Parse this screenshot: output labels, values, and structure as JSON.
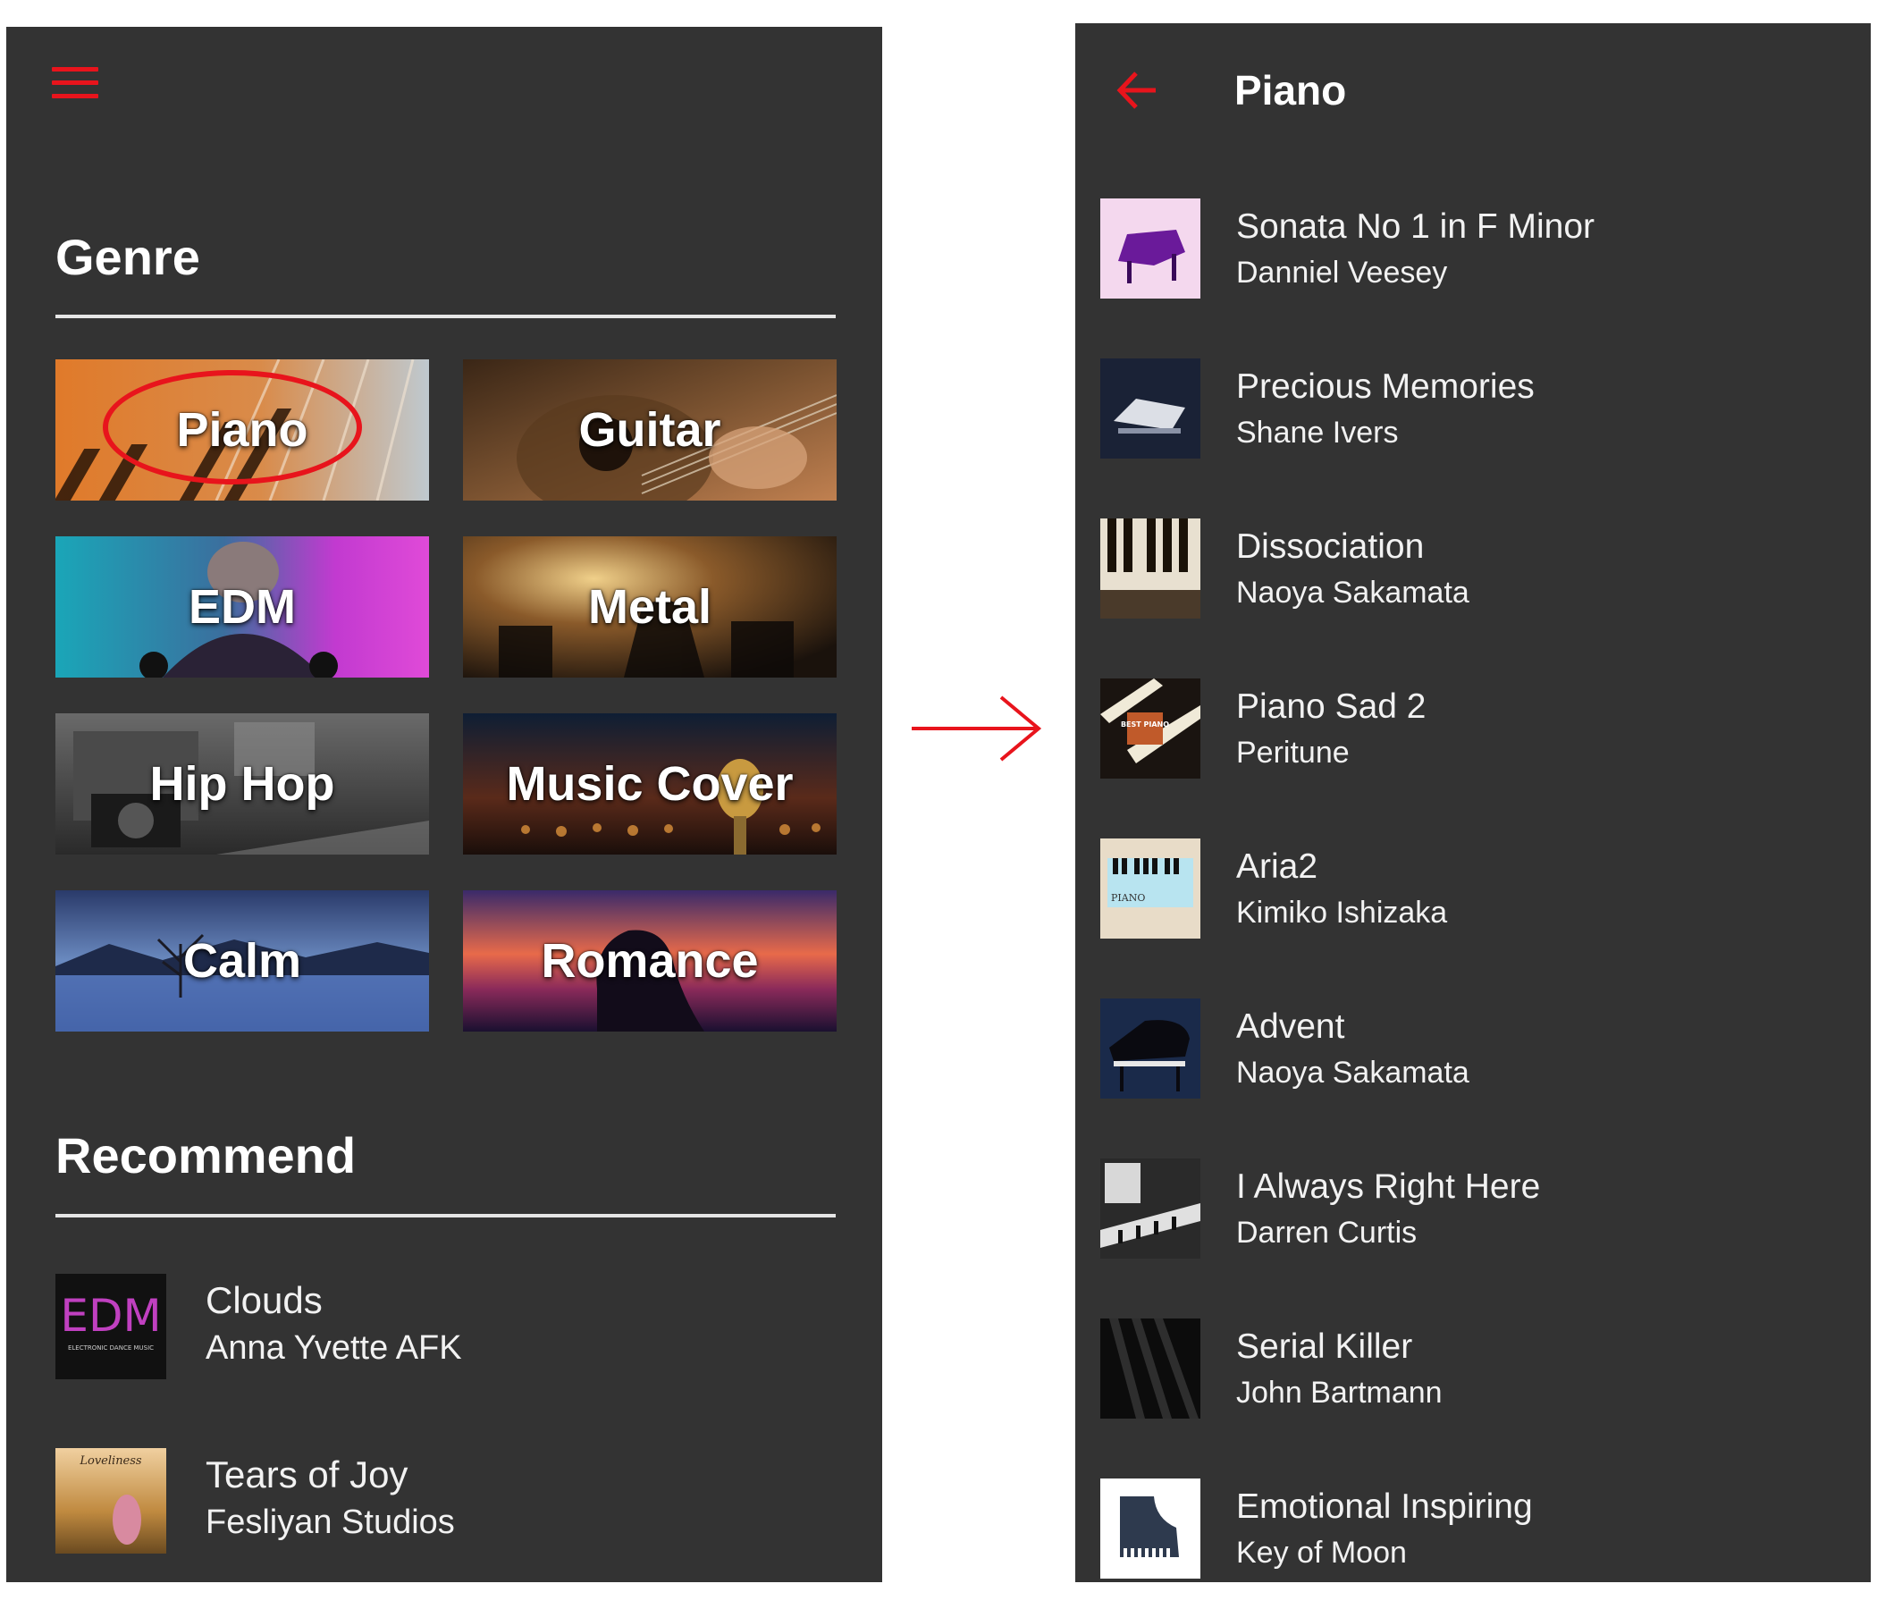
{
  "left_screen": {
    "menu_icon": "hamburger-menu-icon",
    "genre_title": "Genre",
    "genres": [
      {
        "label": "Piano"
      },
      {
        "label": "Guitar"
      },
      {
        "label": "EDM"
      },
      {
        "label": "Metal"
      },
      {
        "label": "Hip Hop"
      },
      {
        "label": "Music Cover"
      },
      {
        "label": "Calm"
      },
      {
        "label": "Romance"
      }
    ],
    "recommend_title": "Recommend",
    "recommendations": [
      {
        "title": "Clouds",
        "artist": "Anna Yvette AFK",
        "cover_text": "EDM",
        "cover_subtext": "ELECTRONIC DANCE MUSIC"
      },
      {
        "title": "Tears of Joy",
        "artist": "Fesliyan Studios",
        "cover_text": "Loveliness"
      }
    ]
  },
  "right_screen": {
    "back_icon": "back-arrow-icon",
    "title": "Piano",
    "tracks": [
      {
        "title": "Sonata No 1 in F Minor",
        "artist": "Danniel Veesey"
      },
      {
        "title": "Precious Memories",
        "artist": "Shane Ivers"
      },
      {
        "title": "Dissociation",
        "artist": "Naoya Sakamata"
      },
      {
        "title": "Piano Sad 2",
        "artist": "Peritune",
        "cover_text": "BEST PIANO"
      },
      {
        "title": "Aria2",
        "artist": "Kimiko Ishizaka",
        "cover_text": "PIANO"
      },
      {
        "title": "Advent",
        "artist": "Naoya Sakamata"
      },
      {
        "title": "I Always Right Here",
        "artist": "Darren Curtis"
      },
      {
        "title": "Serial Killer",
        "artist": "John Bartmann"
      },
      {
        "title": "Emotional Inspiring",
        "artist": "Key of Moon"
      }
    ]
  },
  "colors": {
    "screen_bg": "#333333",
    "accent": "#e8141c",
    "text": "#f2f2f2"
  }
}
